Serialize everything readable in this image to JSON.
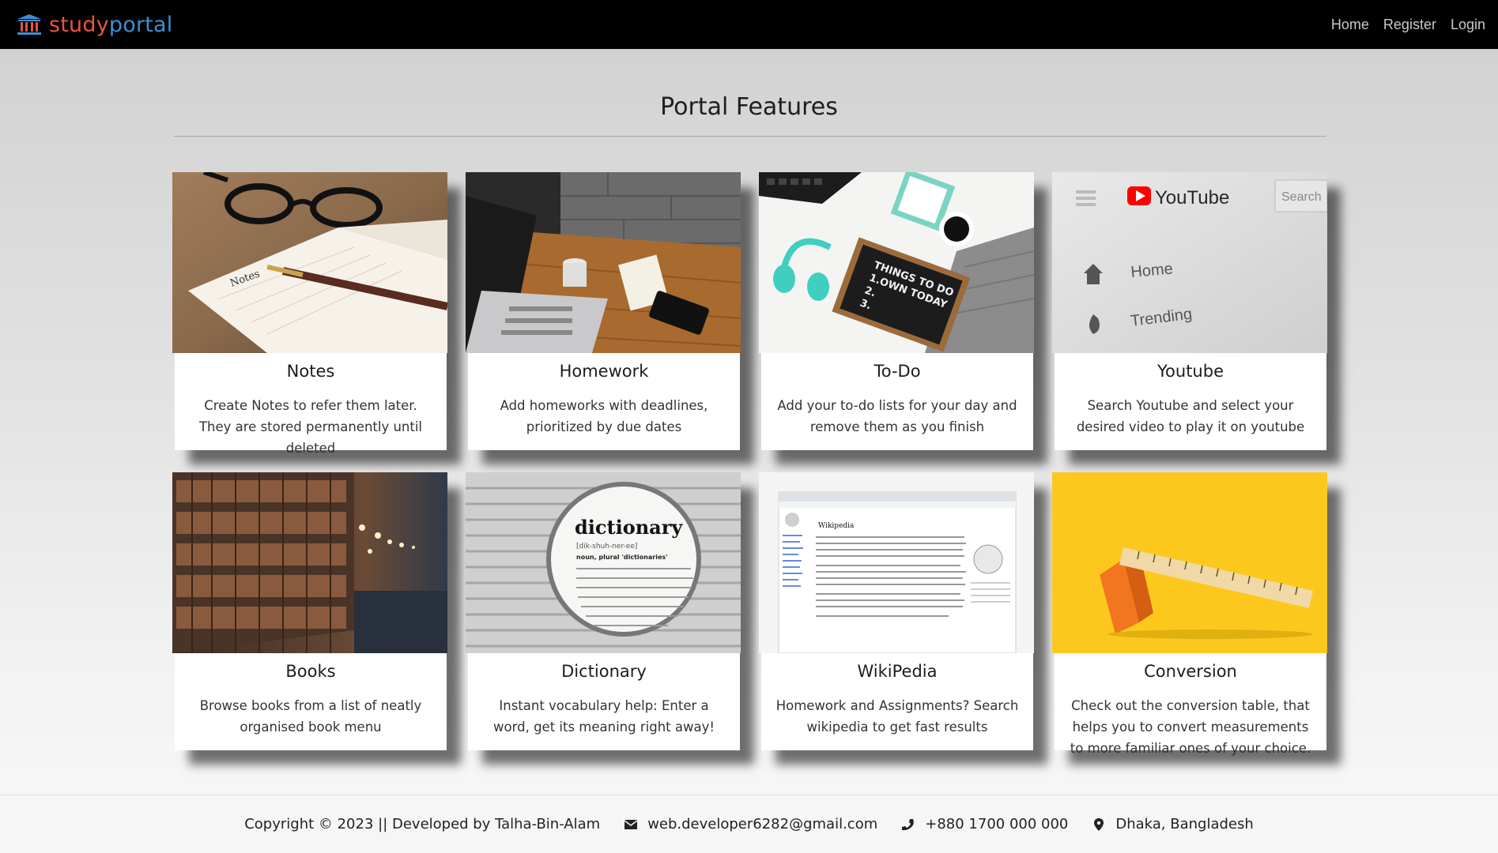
{
  "navbar": {
    "brand_part1": "study",
    "brand_part2": "portal",
    "links": [
      "Home",
      "Register",
      "Login"
    ]
  },
  "page_title": "Portal Features",
  "cards": [
    {
      "title": "Notes",
      "desc": "Create Notes to refer them later. They are stored permanently until deleted"
    },
    {
      "title": "Homework",
      "desc": "Add homeworks with deadlines, prioritized by due dates"
    },
    {
      "title": "To-Do",
      "desc": "Add your to-do lists for your day and remove them as you finish"
    },
    {
      "title": "Youtube",
      "desc": "Search Youtube and select your desired video to play it on youtube"
    },
    {
      "title": "Books",
      "desc": "Browse books from a list of neatly organised book menu"
    },
    {
      "title": "Dictionary",
      "desc": "Instant vocabulary help: Enter a word, get its meaning right away!"
    },
    {
      "title": "WikiPedia",
      "desc": "Homework and Assignments? Search wikipedia to get fast results"
    },
    {
      "title": "Conversion",
      "desc": "Check out the conversion table, that helps you to convert measurements to more familiar ones of your choice."
    }
  ],
  "image_text": {
    "notes_word": "Notes",
    "todo_line1": "THINGS TO DO",
    "todo_line2": "1.OWN TODAY",
    "todo_line3": "2.",
    "todo_line4": "3.",
    "yt_logo": "YouTube",
    "yt_search": "Search",
    "yt_home": "Home",
    "yt_trending": "Trending",
    "dict_word": "dictionary",
    "dict_pron": "[dik-shuh-ner-ee]",
    "dict_noun": "noun, plural 'dictionaries'",
    "wiki_title": "Wikipedia"
  },
  "footer": {
    "copyright": "Copyright © 2023 || Developed by Talha-Bin-Alam",
    "email": "web.developer6282@gmail.com",
    "phone": "+880 1700 000 000",
    "location": "Dhaka, Bangladesh"
  },
  "colors": {
    "navbar_bg": "#000000",
    "brand_study": "#e8543a",
    "brand_portal": "#3b8fd3"
  }
}
